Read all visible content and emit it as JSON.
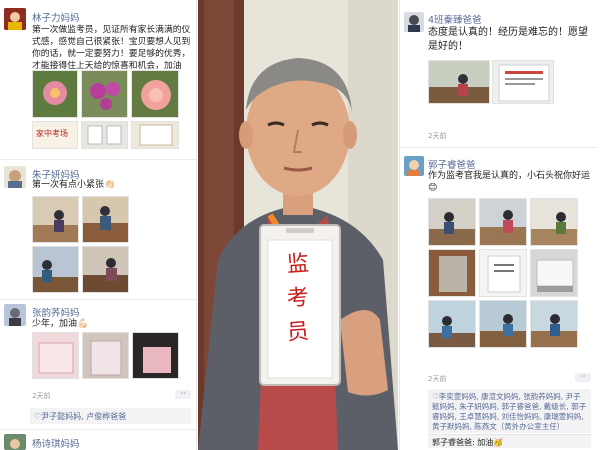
{
  "left_feed": {
    "posts": [
      {
        "author": "林子力妈妈",
        "text": "第一次做监考员，见证所有家长满满的仪式感，感觉自己很紧张！宝贝要想人见到你的话，就一定要努力！要足够的优秀，才能接得住上天给的惊喜和机会，加油💪🏻",
        "image_caption": "家中考场"
      },
      {
        "author": "朱子妍妈妈",
        "text": "第一次有点小紧张👏🏻"
      },
      {
        "author": "张韵荞妈妈",
        "text": "少年，加油💪🏻",
        "time": "2天前",
        "more": "··",
        "likes": "♡尹子懿妈妈, 卢俊桦爸爸"
      },
      {
        "author": "杨诗琪妈妈"
      }
    ]
  },
  "photo": {
    "badge_chars": [
      "监",
      "考",
      "员"
    ]
  },
  "right_feed": {
    "posts": [
      {
        "author": "4班秦臻爸爸",
        "text": "态度是认真的！经历是难忘的！愿望是好的！",
        "time": "2天前"
      },
      {
        "author": "郭子睿爸爸",
        "text": "作为监考官我是认真的，小石头祝你好运😊",
        "time": "2天前",
        "more": "··",
        "likes": "♡李奕萱妈妈, 康渲文妈妈, 张韵荞妈妈, 尹子懿妈妈, 朱子妍妈妈, 郭子睿爸爸, 戴级长, 郭子睿妈妈, 王卓慧妈妈, 刘佳怡妈妈, 康瑞萱妈妈, 黄子默妈妈, 陈燕文（黄外办公室主任）",
        "comment": "郭子睿爸爸: 加油🥳"
      }
    ]
  }
}
